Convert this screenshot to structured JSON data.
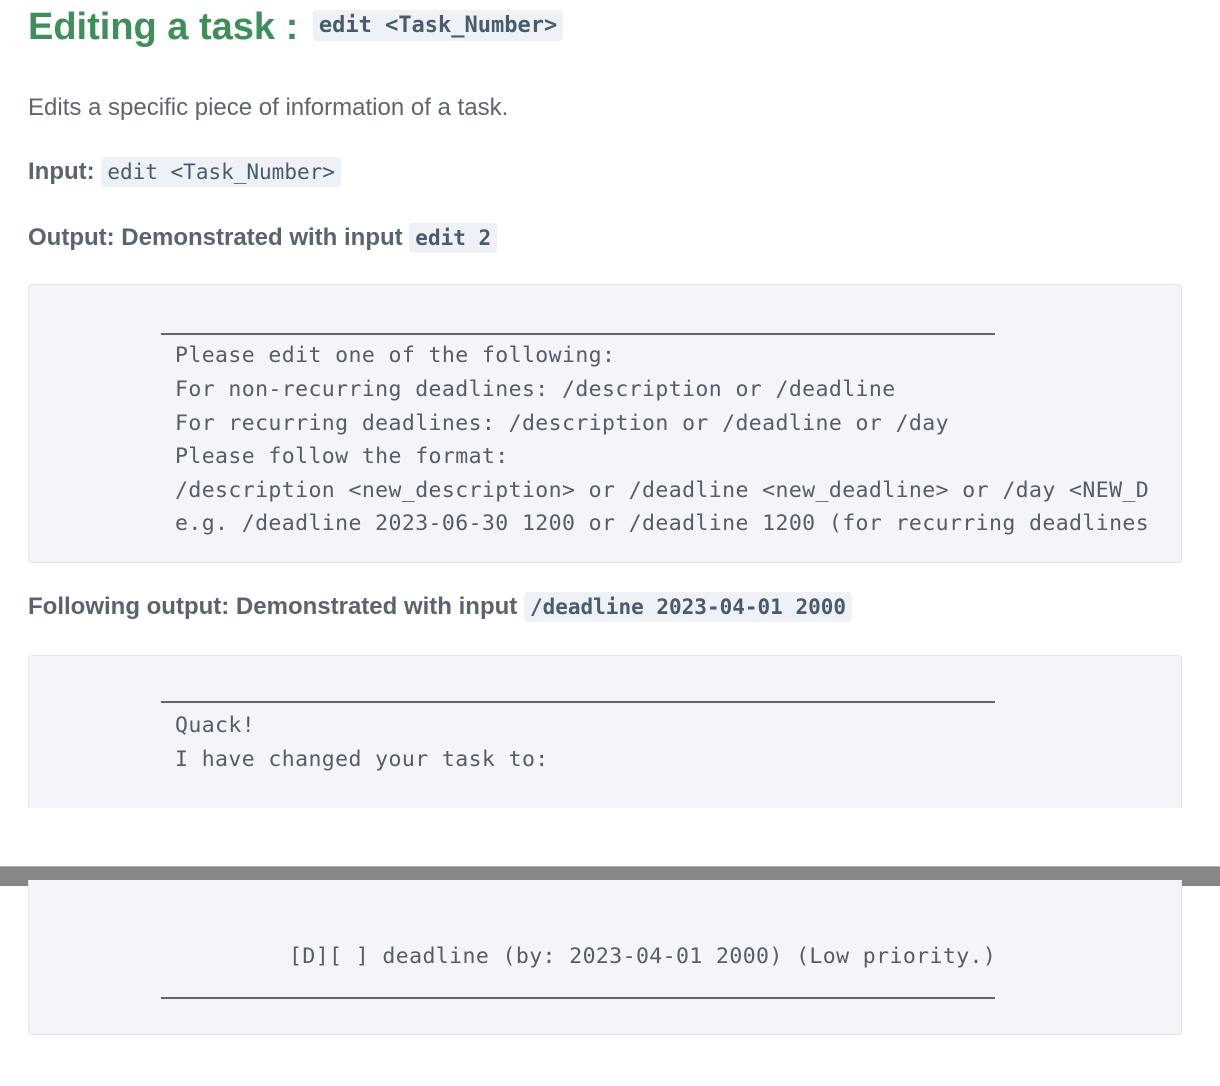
{
  "heading": {
    "title": "Editing a task :",
    "command": "edit <Task_Number>"
  },
  "description": "Edits a specific piece of information of a task.",
  "input": {
    "label": "Input:",
    "value": "edit <Task_Number>"
  },
  "output": {
    "label": "Output: Demonstrated with input",
    "value": "edit 2",
    "lines": [
      "Please edit one of the following:",
      "For non-recurring deadlines: /description or /deadline",
      "For recurring deadlines: /description or /deadline or /day",
      "Please follow the format:",
      "/description <new_description> or /deadline <new_deadline> or /day <NEW_D",
      "e.g. /deadline 2023-06-30 1200 or /deadline 1200 (for recurring deadlines"
    ]
  },
  "following": {
    "label": "Following output: Demonstrated with input",
    "value": "/deadline 2023-04-01 2000",
    "lines": [
      "Quack!",
      "I have changed your task to:"
    ],
    "task_line": "[D][ ] deadline (by: 2023-04-01 2000) (Low priority.)"
  }
}
